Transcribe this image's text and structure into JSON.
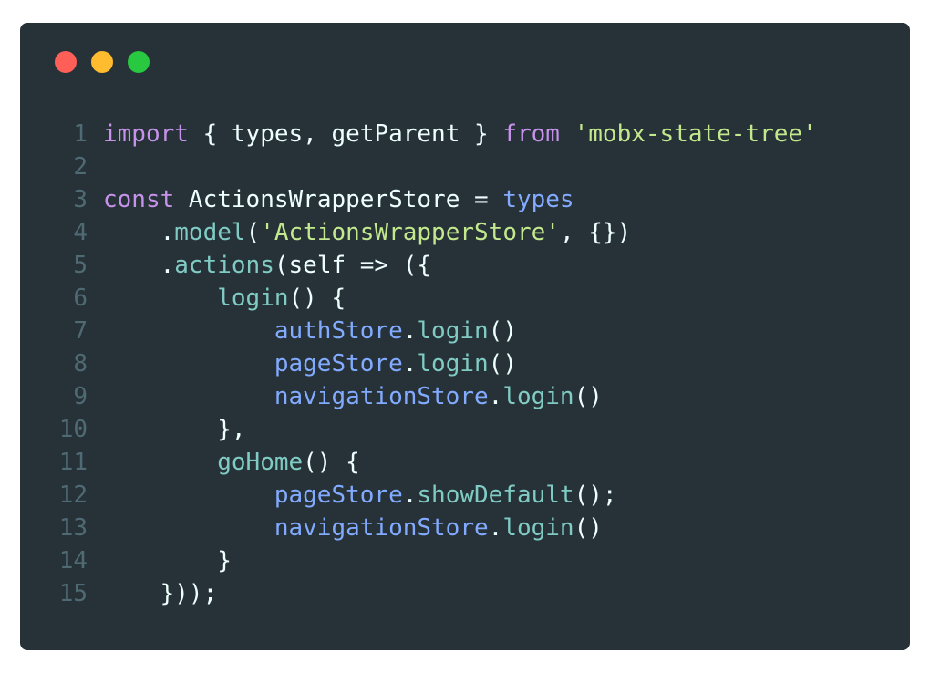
{
  "window": {
    "controls": [
      "close",
      "minimize",
      "maximize"
    ],
    "colors": {
      "background": "#263238",
      "close": "#ff5f57",
      "minimize": "#febc2e",
      "maximize": "#28c840"
    }
  },
  "code": {
    "language": "javascript",
    "lines": [
      {
        "n": "1",
        "tokens": [
          {
            "t": "import",
            "c": "kw"
          },
          {
            "t": " { ",
            "c": "plain"
          },
          {
            "t": "types",
            "c": "plain"
          },
          {
            "t": ", ",
            "c": "plain"
          },
          {
            "t": "getParent",
            "c": "plain"
          },
          {
            "t": " } ",
            "c": "plain"
          },
          {
            "t": "from",
            "c": "kw"
          },
          {
            "t": " ",
            "c": "plain"
          },
          {
            "t": "'mobx-state-tree'",
            "c": "str"
          }
        ]
      },
      {
        "n": "2",
        "tokens": []
      },
      {
        "n": "3",
        "tokens": [
          {
            "t": "const",
            "c": "kw"
          },
          {
            "t": " ActionsWrapperStore = ",
            "c": "plain"
          },
          {
            "t": "types",
            "c": "id"
          }
        ]
      },
      {
        "n": "4",
        "tokens": [
          {
            "t": "    .",
            "c": "plain"
          },
          {
            "t": "model",
            "c": "meth"
          },
          {
            "t": "(",
            "c": "plain"
          },
          {
            "t": "'ActionsWrapperStore'",
            "c": "str"
          },
          {
            "t": ", {})",
            "c": "plain"
          }
        ]
      },
      {
        "n": "5",
        "tokens": [
          {
            "t": "    .",
            "c": "plain"
          },
          {
            "t": "actions",
            "c": "meth"
          },
          {
            "t": "(self => ({",
            "c": "plain"
          }
        ]
      },
      {
        "n": "6",
        "tokens": [
          {
            "t": "        ",
            "c": "plain"
          },
          {
            "t": "login",
            "c": "meth"
          },
          {
            "t": "() {",
            "c": "plain"
          }
        ]
      },
      {
        "n": "7",
        "tokens": [
          {
            "t": "            ",
            "c": "plain"
          },
          {
            "t": "authStore",
            "c": "id"
          },
          {
            "t": ".",
            "c": "plain"
          },
          {
            "t": "login",
            "c": "meth"
          },
          {
            "t": "()",
            "c": "plain"
          }
        ]
      },
      {
        "n": "8",
        "tokens": [
          {
            "t": "            ",
            "c": "plain"
          },
          {
            "t": "pageStore",
            "c": "id"
          },
          {
            "t": ".",
            "c": "plain"
          },
          {
            "t": "login",
            "c": "meth"
          },
          {
            "t": "()",
            "c": "plain"
          }
        ]
      },
      {
        "n": "9",
        "tokens": [
          {
            "t": "            ",
            "c": "plain"
          },
          {
            "t": "navigationStore",
            "c": "id"
          },
          {
            "t": ".",
            "c": "plain"
          },
          {
            "t": "login",
            "c": "meth"
          },
          {
            "t": "()",
            "c": "plain"
          }
        ]
      },
      {
        "n": "10",
        "tokens": [
          {
            "t": "        },",
            "c": "plain"
          }
        ]
      },
      {
        "n": "11",
        "tokens": [
          {
            "t": "        ",
            "c": "plain"
          },
          {
            "t": "goHome",
            "c": "meth"
          },
          {
            "t": "() {",
            "c": "plain"
          }
        ]
      },
      {
        "n": "12",
        "tokens": [
          {
            "t": "            ",
            "c": "plain"
          },
          {
            "t": "pageStore",
            "c": "id"
          },
          {
            "t": ".",
            "c": "plain"
          },
          {
            "t": "showDefault",
            "c": "meth"
          },
          {
            "t": "();",
            "c": "plain"
          }
        ]
      },
      {
        "n": "13",
        "tokens": [
          {
            "t": "            ",
            "c": "plain"
          },
          {
            "t": "navigationStore",
            "c": "id"
          },
          {
            "t": ".",
            "c": "plain"
          },
          {
            "t": "login",
            "c": "meth"
          },
          {
            "t": "()",
            "c": "plain"
          }
        ]
      },
      {
        "n": "14",
        "tokens": [
          {
            "t": "        }",
            "c": "plain"
          }
        ]
      },
      {
        "n": "15",
        "tokens": [
          {
            "t": "    }));",
            "c": "plain"
          }
        ]
      }
    ]
  }
}
